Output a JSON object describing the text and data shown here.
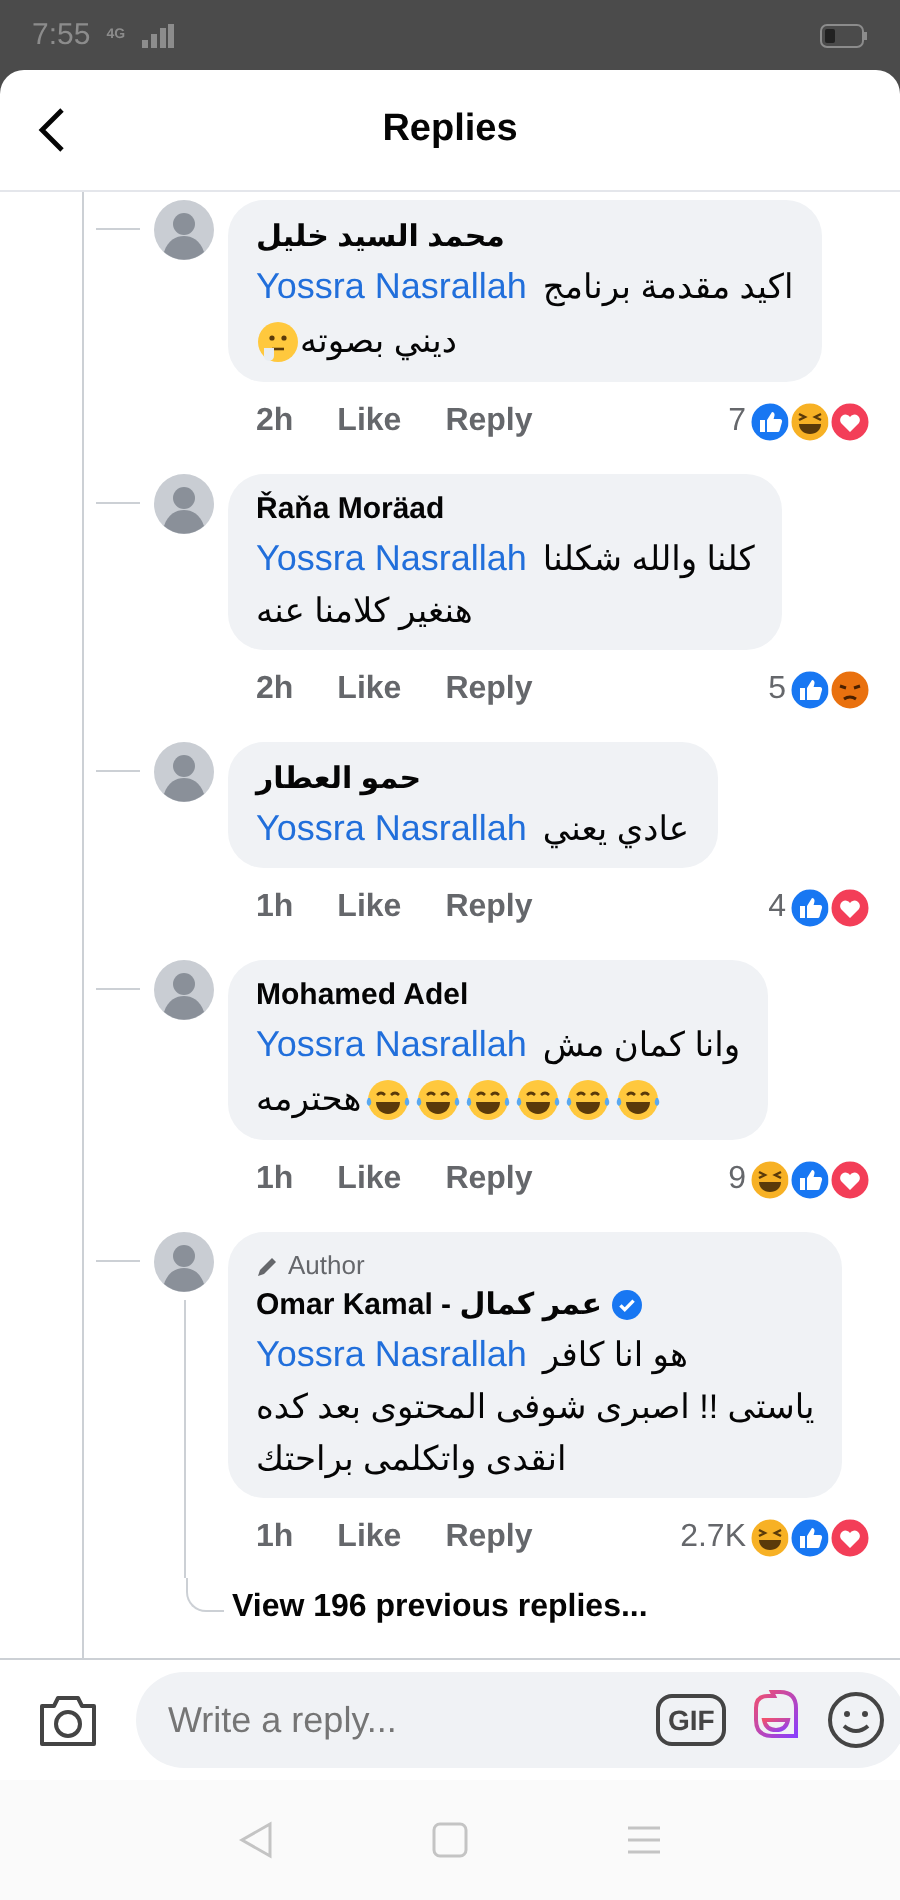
{
  "status_bar": {
    "time": "7:55",
    "network": "4G"
  },
  "header": {
    "title": "Replies"
  },
  "comments": [
    {
      "author": "محمد السيد خليل",
      "mention": "Yossra Nasrallah",
      "lines": [
        [
          {
            "kind": "text",
            "text": "اكيد مقدمة برنامج"
          }
        ],
        [
          {
            "kind": "thinking-emoji"
          },
          {
            "kind": "text",
            "text": "ديني بصوته"
          }
        ]
      ],
      "time": "2h",
      "like": "Like",
      "reply": "Reply",
      "count": "7",
      "reactions": [
        {
          "kind": "like"
        },
        {
          "kind": "haha"
        },
        {
          "kind": "love"
        }
      ]
    },
    {
      "author": "Řaňa Moräad",
      "mention": "Yossra Nasrallah",
      "lines": [
        [
          {
            "kind": "text",
            "text": "كلنا والله شكلنا"
          }
        ],
        [
          {
            "kind": "text",
            "text": "هنغير كلامنا عنه"
          }
        ]
      ],
      "time": "2h",
      "like": "Like",
      "reply": "Reply",
      "count": "5",
      "reactions": [
        {
          "kind": "like"
        },
        {
          "kind": "angry"
        }
      ]
    },
    {
      "author": "حمو العطار",
      "mention": "Yossra Nasrallah",
      "lines": [
        [
          {
            "kind": "text",
            "text": "عادي يعني"
          }
        ]
      ],
      "time": "1h",
      "like": "Like",
      "reply": "Reply",
      "count": "4",
      "reactions": [
        {
          "kind": "like"
        },
        {
          "kind": "love"
        }
      ]
    },
    {
      "author": "Mohamed Adel",
      "mention": "Yossra Nasrallah",
      "lines": [
        [
          {
            "kind": "text",
            "text": "وانا كمان مش"
          }
        ],
        [
          {
            "kind": "text",
            "text": "هحترمه"
          },
          {
            "kind": "tears-of-joy-emoji"
          },
          {
            "kind": "tears-of-joy-emoji"
          },
          {
            "kind": "tears-of-joy-emoji"
          },
          {
            "kind": "tears-of-joy-emoji"
          },
          {
            "kind": "tears-of-joy-emoji"
          },
          {
            "kind": "tears-of-joy-emoji"
          }
        ]
      ],
      "time": "1h",
      "like": "Like",
      "reply": "Reply",
      "count": "9",
      "reactions": [
        {
          "kind": "haha"
        },
        {
          "kind": "like"
        },
        {
          "kind": "love"
        }
      ]
    },
    {
      "author": "Omar Kamal - عمر كمال",
      "badge": "Author",
      "verified": true,
      "mention": "Yossra Nasrallah",
      "lines": [
        [
          {
            "kind": "text",
            "text": "هو انا كافر"
          }
        ],
        [
          {
            "kind": "text",
            "text": "ياستى !! اصبرى شوفى المحتوى بعد كده"
          }
        ],
        [
          {
            "kind": "text",
            "text": "انقدى واتكلمى براحتك"
          }
        ]
      ],
      "time": "1h",
      "like": "Like",
      "reply": "Reply",
      "count": "2.7K",
      "reactions": [
        {
          "kind": "haha"
        },
        {
          "kind": "like"
        },
        {
          "kind": "love"
        }
      ]
    }
  ],
  "view_more": "View 196 previous replies...",
  "composer": {
    "placeholder": "Write a reply...",
    "gif_label": "GIF"
  }
}
